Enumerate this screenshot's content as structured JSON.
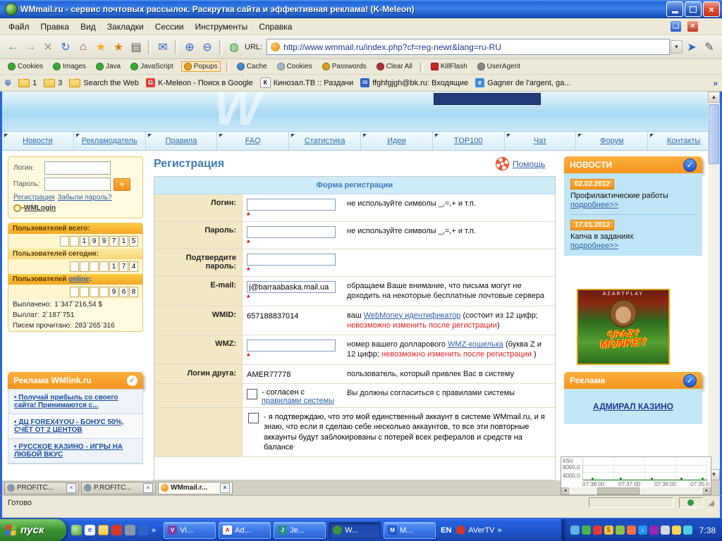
{
  "window": {
    "title": "WMmail.ru - сервис почтовых рассылок. Раскрутка сайта и эффективная реклама! (K-Meleon)",
    "status": "Готово"
  },
  "menubar": {
    "items": [
      {
        "label": "Файл"
      },
      {
        "label": "Правка"
      },
      {
        "label": "Вид"
      },
      {
        "label": "Закладки"
      },
      {
        "label": "Сессии"
      },
      {
        "label": "Инструменты"
      },
      {
        "label": "Справка"
      }
    ]
  },
  "toolbar": {
    "url_label": "URL:",
    "url_value": "http://www.wmmail.ru/index.php?cf=reg-newr&lang=ru-RU"
  },
  "privacybar": {
    "items": [
      {
        "label": "Cookies"
      },
      {
        "label": "Images"
      },
      {
        "label": "Java"
      },
      {
        "label": "JavaScript"
      },
      {
        "label": "Popups"
      },
      {
        "label": "Cache"
      },
      {
        "label": "Cookies"
      },
      {
        "label": "Passwords"
      },
      {
        "label": "Clear All"
      },
      {
        "label": "KillFlash"
      },
      {
        "label": "UserAgent"
      }
    ]
  },
  "bookmarksbar": {
    "items": [
      {
        "label": "1"
      },
      {
        "label": "3"
      },
      {
        "label": "Search the Web"
      },
      {
        "label": "K-Meleon - Поиск в Google"
      },
      {
        "label": "Кинозал.ТВ :: Раздачи"
      },
      {
        "label": "ffghfgjgh@bk.ru: Входящие"
      },
      {
        "label": "Gagner de l'argent, ga..."
      }
    ]
  },
  "nav": {
    "items": [
      {
        "label": "Новости"
      },
      {
        "label": "Рекламодатель"
      },
      {
        "label": "Правила"
      },
      {
        "label": "FAQ"
      },
      {
        "label": "Статистика"
      },
      {
        "label": "Идеи"
      },
      {
        "label": "TOP100"
      },
      {
        "label": "Чат"
      },
      {
        "label": "Форум"
      },
      {
        "label": "Контакты"
      }
    ]
  },
  "sidebar": {
    "login_label": "Логин:",
    "password_label": "Пароль:",
    "register_link": "Регистрация",
    "forgot_link": "Забыли пароль?",
    "wmlogin": "WMLogin",
    "stats_total": {
      "label": "Пользователей всего:",
      "digits": [
        "",
        "",
        "1",
        "9",
        "9",
        "7",
        "1",
        "5"
      ]
    },
    "stats_today": {
      "label": "Пользователей сегодня:",
      "digits": [
        "",
        "",
        "",
        "",
        "1",
        "7",
        "4"
      ]
    },
    "stats_online": {
      "prefix": "Пользователей",
      "link": "online",
      "suffix": ":",
      "digits": [
        "",
        "",
        "",
        "",
        "9",
        "6",
        "8"
      ]
    },
    "totals": [
      {
        "label": "Выплачено:",
        "value": "1`347`216,54 $"
      },
      {
        "label": "Выплат:",
        "value": "2`187`751"
      },
      {
        "label": "Писем прочитано:",
        "value": "283`265`316"
      }
    ],
    "wmlink": {
      "title": "Реклама WMlink.ru",
      "ads": [
        {
          "text": "• Получай прибыль со своего сайта! Принимаются с..."
        },
        {
          "text": "• ДЦ FOREX4YOU - БОНУС 50%, СЧЁТ ОТ 2 ЦЕНТОВ"
        },
        {
          "text": "• РУССКОЕ КАЗИНО - ИГРЫ НА ЛЮБОЙ ВКУС"
        }
      ]
    }
  },
  "main": {
    "title": "Регистрация",
    "help": "Помощь",
    "required_mark": "*",
    "form": {
      "title": "Форма регистрации",
      "login": {
        "label": "Логин:",
        "desc": "не используйте символы _,=,+ и т.п."
      },
      "password": {
        "label": "Пароль:",
        "desc": "не используйте символы _,=,+ и т.п."
      },
      "confirm": {
        "label": "Подтвердите пароль:"
      },
      "email": {
        "label": "E-mail:",
        "value": "j@barraabaska.mail.ua",
        "desc": "обращаем Ваше внимание, что письма могут не доходить на некоторые бесплатные почтовые сервера"
      },
      "wmid": {
        "label": "WMID:",
        "value": "657188837014",
        "desc": [
          {
            "t": "ваш ",
            "c": ""
          },
          {
            "t": "WebMoney идентификатор",
            "c": "link"
          },
          {
            "t": " (состоит из 12 цифр; ",
            "c": ""
          },
          {
            "t": "невозможно изменить после регистрации",
            "c": "red"
          },
          {
            "t": ")",
            "c": ""
          }
        ]
      },
      "wmz": {
        "label": "WMZ:",
        "desc": [
          {
            "t": "номер вашего долларового ",
            "c": ""
          },
          {
            "t": "WMZ-кошелька",
            "c": "link"
          },
          {
            "t": " (буква Z и 12 цифр; ",
            "c": ""
          },
          {
            "t": "невозможно изменить после регистрации",
            "c": "red"
          },
          {
            "t": " )",
            "c": ""
          }
        ]
      },
      "friend": {
        "label": "Логин друга:",
        "value": "AMER77778",
        "desc": "пользователь, который привлек Вас в систему"
      },
      "agree": {
        "text": [
          {
            "t": "- согласен с ",
            "c": ""
          },
          {
            "t": "правилами системы",
            "c": "link"
          }
        ],
        "desc": "Вы должны согласиться с правилами системы"
      },
      "single": {
        "text": "- я подтверждаю, что это мой единственный аккаунт в системе WMmail.ru, и я знаю, что если я сделаю себе несколько аккаунтов, то все эти повторные аккаунты будут заблокированы с потерей всех рефералов и средств на балансе"
      }
    }
  },
  "news": {
    "title": "НОВОСТИ",
    "items": [
      {
        "date": "02.02.2012",
        "text": "Профилактические работы",
        "more": "подробнее>>"
      },
      {
        "date": "17.01.2012",
        "text": "Капча в заданиях",
        "more": "подробнее>>"
      }
    ]
  },
  "casino": {
    "brand": "AZARTPLAY",
    "name_top": "CRAZY",
    "name_bottom": "MONKEY"
  },
  "promo": {
    "title": "Реклама",
    "link": "АДМИРАЛ КАЗИНО"
  },
  "graph": {
    "unit": "Кб/с",
    "y_labels": [
      "8000,0",
      "4000,0"
    ],
    "times": [
      "07:38:00",
      "07:37:00",
      "07:36:00",
      "07:35:0"
    ]
  },
  "tabs": {
    "items": [
      {
        "label": "PROFITC..."
      },
      {
        "label": "P.ROFITC..."
      },
      {
        "label": "WMmail.r..."
      }
    ]
  },
  "taskbar": {
    "start": "пуск",
    "buttons": [
      {
        "label": "Vi..."
      },
      {
        "label": "Ad..."
      },
      {
        "label": "Je..."
      },
      {
        "label": "W..."
      },
      {
        "label": "M..."
      }
    ],
    "lang": "EN",
    "avertv": "AVerTV",
    "clock": "7:38"
  },
  "colors": {
    "accent_orange": "#F7941D",
    "link_blue": "#2E5FA8",
    "error_red": "#E02020",
    "taskbar_blue": "#2663E0",
    "start_green": "#3D9434",
    "news_bg": "#BFE5F6"
  }
}
